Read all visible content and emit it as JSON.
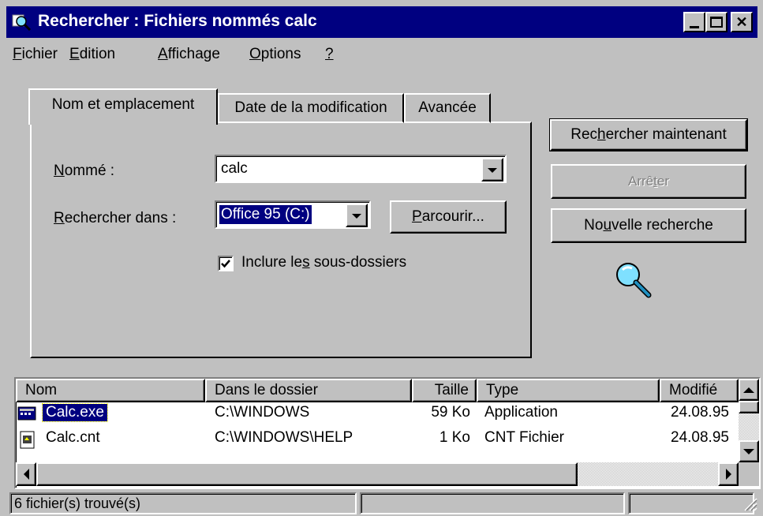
{
  "window": {
    "title": "Rechercher : Fichiers nommés calc"
  },
  "menu": {
    "items": [
      {
        "label": "Fichier",
        "accel": "F",
        "rest": "ichier"
      },
      {
        "label": "Edition",
        "accel": "E",
        "rest": "dition"
      },
      {
        "label": "Affichage",
        "accel": "A",
        "rest": "ffichage"
      },
      {
        "label": "Options",
        "accel": "O",
        "rest": "ptions"
      },
      {
        "label": "?",
        "accel": "?",
        "rest": ""
      }
    ]
  },
  "tabs": [
    {
      "label": "Nom et emplacement",
      "active": true
    },
    {
      "label": "Date de la modification",
      "active": false
    },
    {
      "label": "Avancée",
      "active": false
    }
  ],
  "form": {
    "named_label_accel": "N",
    "named_label_rest": "ommé :",
    "named_value": "calc",
    "lookin_label_accel": "R",
    "lookin_label_rest": "echercher dans :",
    "lookin_value": "Office 95 (C:)",
    "browse_accel": "P",
    "browse_rest": "arcourir...",
    "subfolders_pre": "Inclure le",
    "subfolders_accel": "s",
    "subfolders_post": " sous-dossiers",
    "subfolders_checked": true
  },
  "buttons": {
    "find_now_pre": "Rec",
    "find_now_accel": "h",
    "find_now_post": "ercher maintenant",
    "stop_pre": "Arrê",
    "stop_accel": "t",
    "stop_post": "er",
    "new_search_pre": "No",
    "new_search_accel": "u",
    "new_search_post": "velle recherche"
  },
  "results": {
    "columns": [
      "Nom",
      "Dans le dossier",
      "Taille",
      "Type",
      "Modifié"
    ],
    "rows": [
      {
        "name": "Calc.exe",
        "folder": "C:\\WINDOWS",
        "size": "59 Ko",
        "type": "Application",
        "modified": "24.08.95",
        "selected": true,
        "icon": "calculator-exe-icon"
      },
      {
        "name": "Calc.cnt",
        "folder": "C:\\WINDOWS\\HELP",
        "size": "1 Ko",
        "type": "CNT Fichier",
        "modified": "24.08.95",
        "selected": false,
        "icon": "cnt-file-icon"
      }
    ]
  },
  "status": {
    "count_text": "6 fichier(s) trouvé(s)"
  }
}
